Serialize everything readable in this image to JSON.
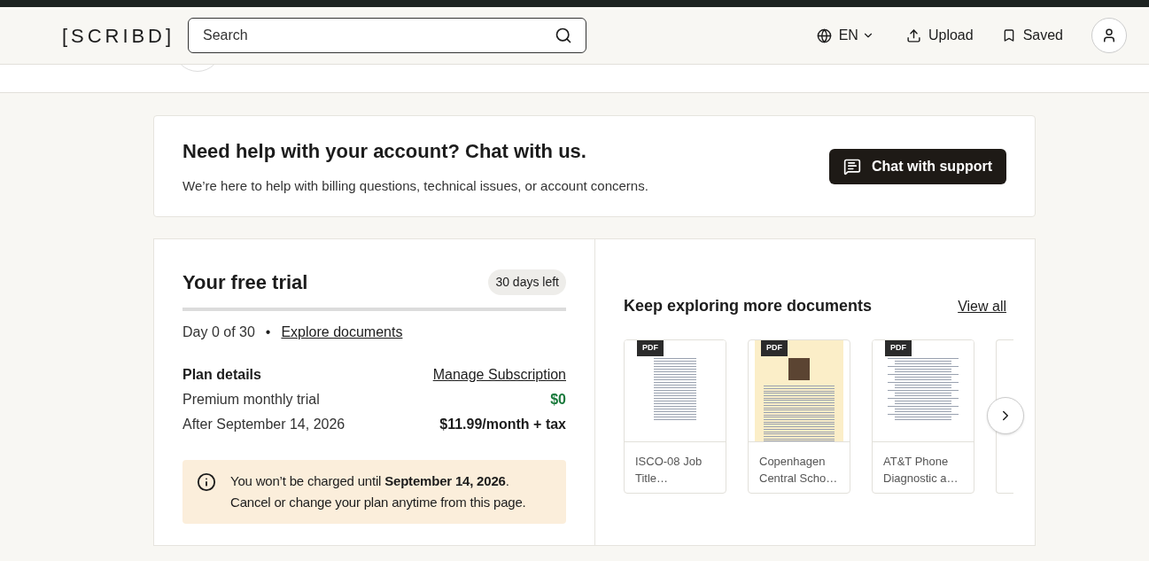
{
  "header": {
    "logo": "[SCRIBD]",
    "search": {
      "placeholder": "Search"
    },
    "language": "EN",
    "upload": "Upload",
    "saved": "Saved"
  },
  "help_card": {
    "title": "Need help with your account? Chat with us.",
    "text": "We’re here to help with billing questions, technical issues, or account concerns.",
    "button": "Chat with support"
  },
  "trial": {
    "title": "Your free trial",
    "badge": "30 days left",
    "day": "Day 0 of 30",
    "separator": "•",
    "explore_link": "Explore documents",
    "plan_label": "Plan details",
    "manage_link": "Manage Subscription",
    "rows": [
      {
        "label": "Premium monthly trial",
        "value": "$0",
        "kind": "free"
      },
      {
        "label": "After September 14, 2026",
        "value": "$11.99/month + tax",
        "kind": "paid"
      }
    ],
    "notice": [
      "You won’t be charged until **September 14, 2026**.",
      "Cancel or change your plan anytime from this page."
    ]
  },
  "documents": {
    "title": "Keep exploring more documents",
    "view_all": "View all",
    "items": [
      {
        "badge": "PDF",
        "title": "ISCO-08 Job Title…",
        "kind": "table"
      },
      {
        "badge": "PDF",
        "title": "Copenhagen Central Scho…",
        "kind": "flyer"
      },
      {
        "badge": "PDF",
        "title": "AT&T Phone Diagnostic a…",
        "kind": "list"
      }
    ]
  }
}
